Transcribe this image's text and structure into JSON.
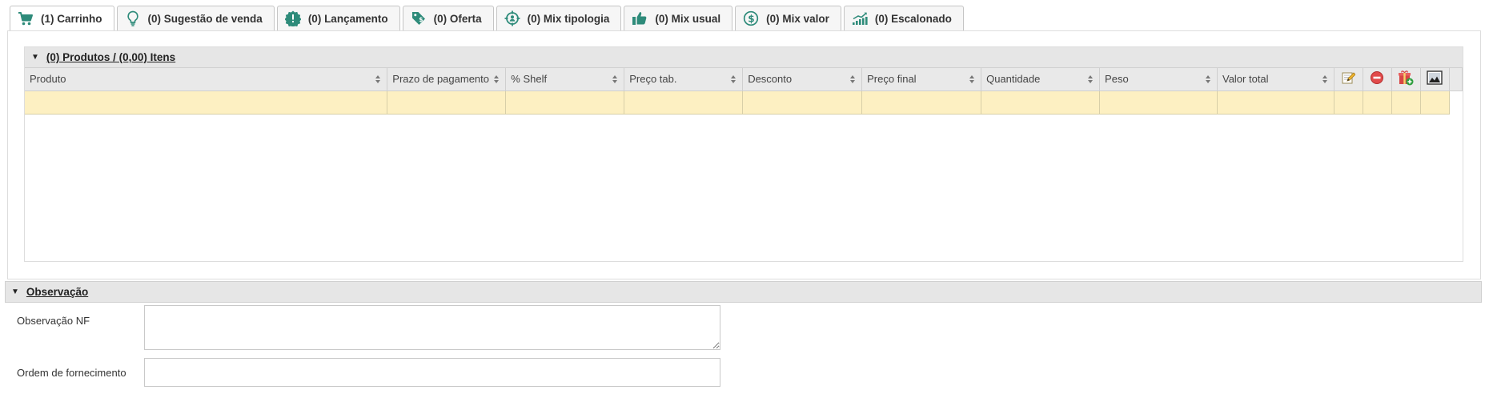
{
  "tabs": [
    {
      "label": "(1) Carrinho",
      "icon": "cart-icon",
      "active": true
    },
    {
      "label": "(0) Sugestão de venda",
      "icon": "lightbulb-icon",
      "active": false
    },
    {
      "label": "(0) Lançamento",
      "icon": "new-badge-icon",
      "active": false
    },
    {
      "label": "(0) Oferta",
      "icon": "price-tag-icon",
      "active": false
    },
    {
      "label": "(0) Mix tipologia",
      "icon": "target-user-icon",
      "active": false
    },
    {
      "label": "(0) Mix usual",
      "icon": "thumbs-up-icon",
      "active": false
    },
    {
      "label": "(0) Mix valor",
      "icon": "dollar-coin-icon",
      "active": false
    },
    {
      "label": "(0) Escalonado",
      "icon": "ascending-chart-icon",
      "active": false
    }
  ],
  "colors": {
    "icon_teal": "#2e8b7a",
    "row_highlight": "#fdf0c2",
    "header_bg": "#e6e6e6"
  },
  "products": {
    "header": "(0) Produtos / (0,00) Itens",
    "columns": [
      "Produto",
      "Prazo de pagamento",
      "% Shelf",
      "Preço tab.",
      "Desconto",
      "Preço final",
      "Quantidade",
      "Peso",
      "Valor total"
    ],
    "icon_columns": [
      "edit-icon",
      "remove-icon",
      "gift-add-icon",
      "image-icon"
    ]
  },
  "observacao": {
    "header": "Observação",
    "nf_label": "Observação NF",
    "nf_value": "",
    "ordem_label": "Ordem de fornecimento",
    "ordem_value": ""
  }
}
